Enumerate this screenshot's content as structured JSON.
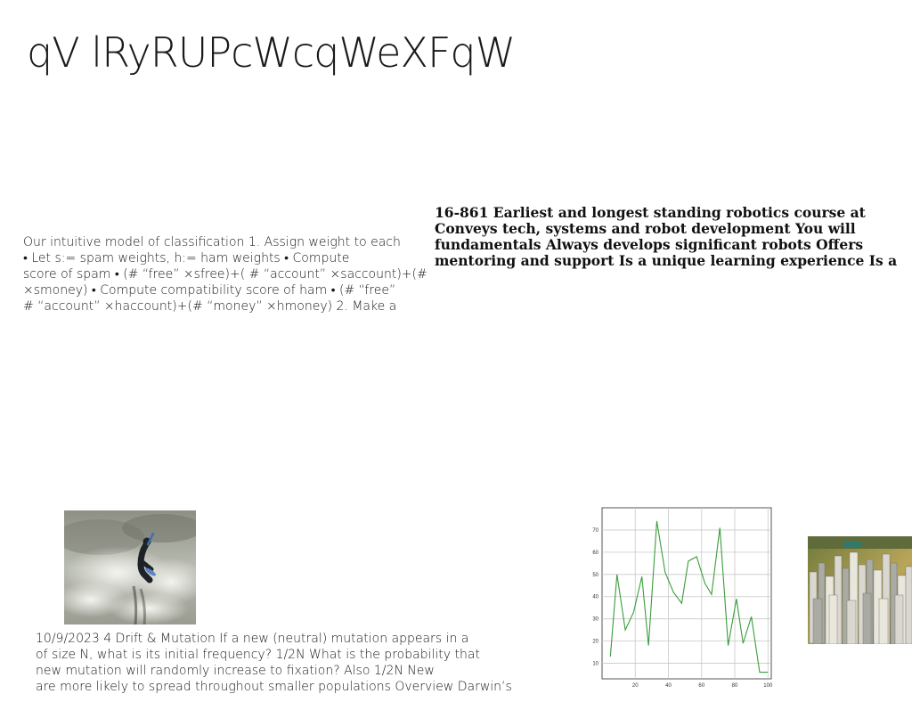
{
  "slide": {
    "title": "qV lRyRUPcWcqWeXFqW"
  },
  "classification_text": {
    "lines": [
      "Our intuitive model of classification 1. Assign weight to each",
      "• Let s:= spam weights, h:= ham weights • Compute",
      "score of spam • (# “free” ×sfree)+( # “account” ×saccount)+(#",
      "×smoney) • Compute compatibility score of ham • (# “free”",
      "# “account” ×haccount)+(# “money” ×hmoney) 2. Make a"
    ]
  },
  "robotics_text": {
    "lines": [
      "16-861 Earliest and longest standing robotics course at",
      "Conveys tech, systems and robot development You will",
      "fundamentals Always develops significant robots Offers",
      "mentoring and support Is a unique learning experience Is a"
    ]
  },
  "drift_text": {
    "lines": [
      "10/9/2023 4 Drift & Mutation  If a new (neutral) mutation appears in a",
      "of size N, what is its initial frequency? 1/2N  What is the probability that",
      "new mutation will randomly increase to fixation? Also 1/2N  New",
      "are more likely to spread throughout smaller populations Overview Darwin’s"
    ]
  },
  "images": {
    "surfer": "photo of a surfer riding a white-water wave",
    "city": "aerial photo of a dense city skyline"
  },
  "chart_data": {
    "type": "line",
    "x": [
      5,
      9,
      14,
      19,
      24,
      28,
      33,
      38,
      43,
      48,
      52,
      57,
      62,
      66,
      71,
      76,
      81,
      85,
      90,
      95,
      100
    ],
    "series": [
      {
        "values": [
          13,
          50,
          25,
          33,
          49,
          18,
          74,
          51,
          42,
          37,
          56,
          58,
          46,
          41,
          71,
          18,
          39,
          19,
          31,
          6,
          6
        ]
      }
    ],
    "xticks": [
      20,
      40,
      60,
      80,
      100
    ],
    "yticks": [
      10,
      20,
      30,
      40,
      50,
      60,
      70
    ],
    "xlim": [
      0,
      102
    ],
    "ylim": [
      3,
      80
    ],
    "grid": true,
    "line_color": "#3a9d3a",
    "title": "",
    "xlabel": "",
    "ylabel": ""
  }
}
